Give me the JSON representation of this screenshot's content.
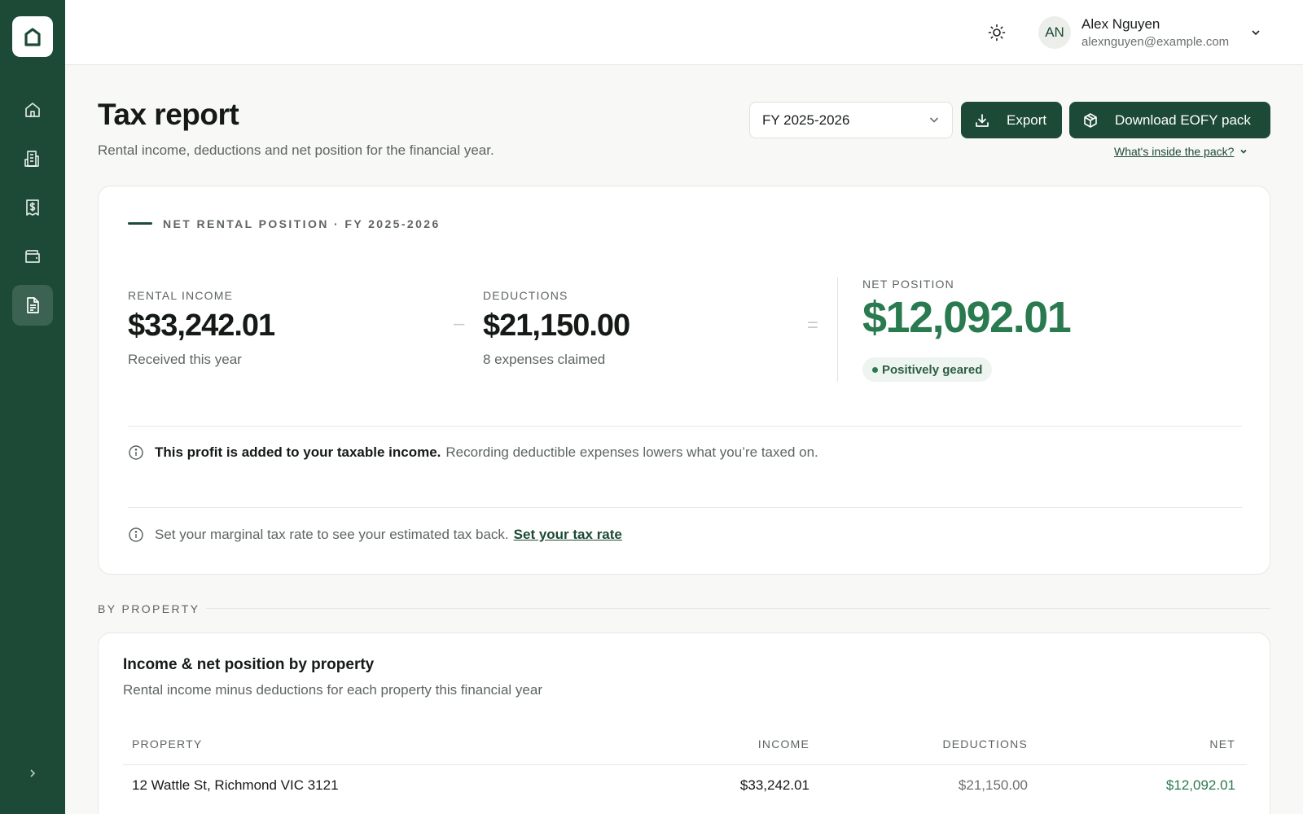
{
  "sidebar": {
    "items": [
      {
        "name": "home",
        "icon": "home-icon",
        "active": false
      },
      {
        "name": "properties",
        "icon": "building-icon",
        "active": false
      },
      {
        "name": "transactions",
        "icon": "receipt-dollar-icon",
        "active": false
      },
      {
        "name": "wallet",
        "icon": "wallet-icon",
        "active": false
      },
      {
        "name": "reports",
        "icon": "document-icon",
        "active": true
      }
    ],
    "accent": "#1d4a36"
  },
  "header": {
    "user": {
      "initials": "AN",
      "name": "Alex Nguyen",
      "email": "alexnguyen@example.com"
    }
  },
  "page": {
    "title": "Tax report",
    "subtitle": "Rental income, deductions and net position for the financial year.",
    "fy_selected": "FY 2025-2026",
    "export_label": "Export",
    "eofy_label": "Download EOFY pack",
    "pack_link": "What's inside the pack?"
  },
  "summary": {
    "eyebrow": "NET RENTAL POSITION · FY 2025-2026",
    "income_label": "RENTAL INCOME",
    "income_value": "$33,242.01",
    "income_sub": "Received this year",
    "minus": "–",
    "deductions_label": "DEDUCTIONS",
    "deductions_value": "$21,150.00",
    "deductions_sub": "8 expenses claimed",
    "equals": "=",
    "net_label": "NET POSITION",
    "net_value": "$12,092.01",
    "net_badge": "Positively geared",
    "info1_bold": "This profit is added to your taxable income.",
    "info1_text": "Recording deductible expenses lowers what you’re taxed on.",
    "info2_text": "Set your marginal tax rate to see your estimated tax back.",
    "info2_link": "Set your tax rate",
    "positive_color": "#2a7a4f"
  },
  "by_property": {
    "section_label": "BY PROPERTY",
    "title": "Income & net position by property",
    "subtitle": "Rental income minus deductions for each property this financial year",
    "columns": {
      "property": "PROPERTY",
      "income": "INCOME",
      "deductions": "DEDUCTIONS",
      "net": "NET"
    },
    "rows": [
      {
        "property": "12 Wattle St, Richmond VIC 3121",
        "income": "$33,242.01",
        "deductions": "$21,150.00",
        "net": "$12,092.01"
      }
    ]
  }
}
